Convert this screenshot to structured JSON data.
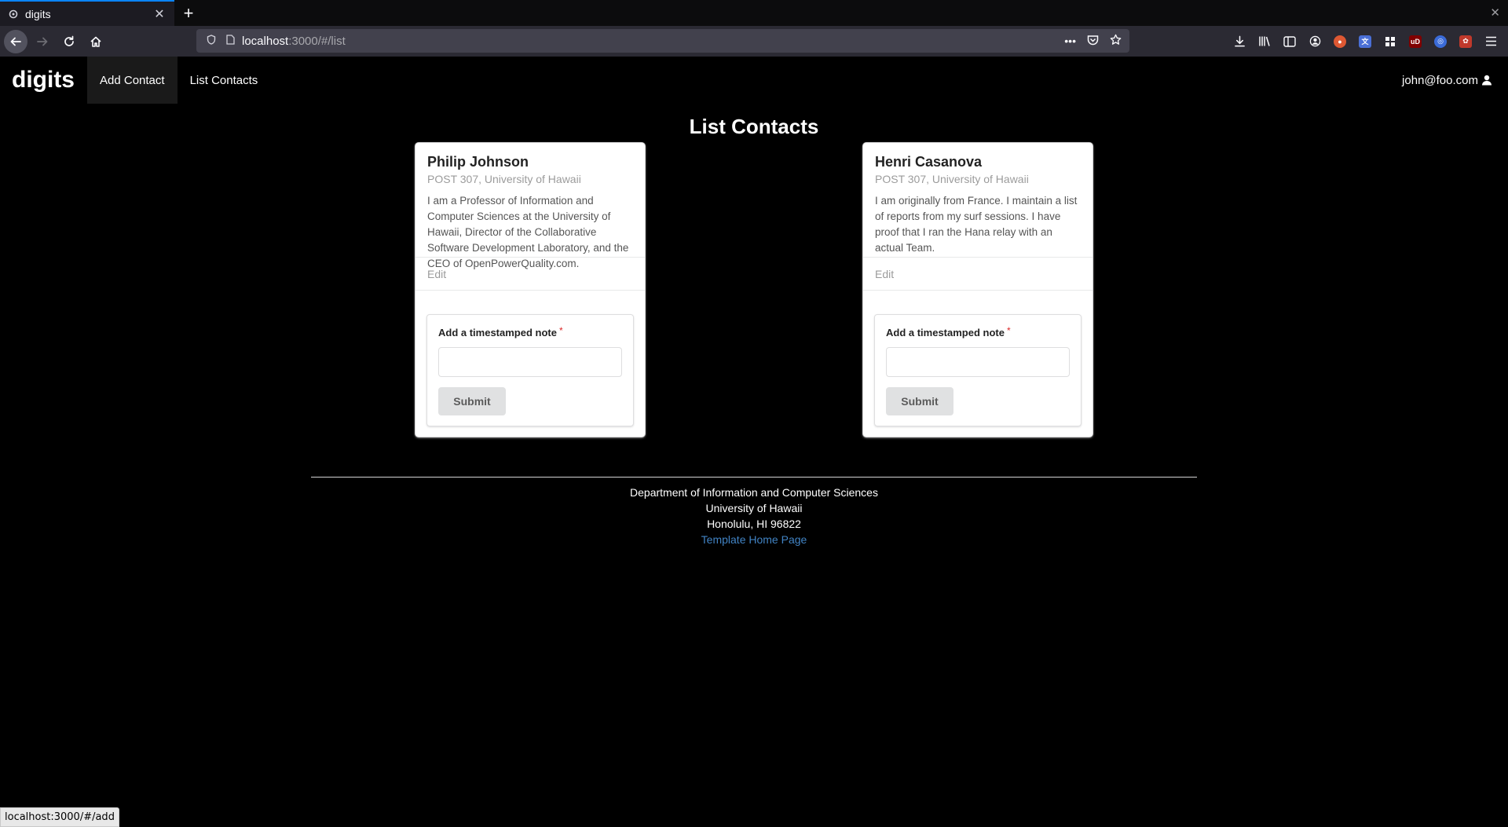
{
  "browser": {
    "tab_title": "digits",
    "new_tab_label": "+",
    "url_host": "localhost",
    "url_path": ":3000/#/list",
    "status_bar_url": "localhost:3000/#/add"
  },
  "app": {
    "brand": "digits",
    "menu": [
      {
        "label": "Add Contact"
      },
      {
        "label": "List Contacts"
      }
    ],
    "user_email": "john@foo.com"
  },
  "page": {
    "title": "List Contacts"
  },
  "contacts": [
    {
      "name": "Philip Johnson",
      "address": "POST 307, University of Hawaii",
      "description": "I am a Professor of Information and Computer Sciences at the University of Hawaii, Director of the Collaborative Software Development Laboratory, and the CEO of OpenPowerQuality.com.",
      "edit_label": "Edit",
      "note_label": "Add a timestamped note",
      "note_value": "",
      "submit_label": "Submit"
    },
    {
      "name": "Henri Casanova",
      "address": "POST 307, University of Hawaii",
      "description": "I am originally from France. I maintain a list of reports from my surf sessions. I have proof that I ran the Hana relay with an actual Team.",
      "edit_label": "Edit",
      "note_label": "Add a timestamped note",
      "note_value": "",
      "submit_label": "Submit"
    }
  ],
  "footer": {
    "line1": "Department of Information and Computer Sciences",
    "line2": "University of Hawaii",
    "line3": "Honolulu, HI 96822",
    "link": "Template Home Page"
  },
  "colors": {
    "page_background": "#000000",
    "link": "#4183c4",
    "required_star": "#db2828",
    "browser_accent": "#0a84ff"
  }
}
